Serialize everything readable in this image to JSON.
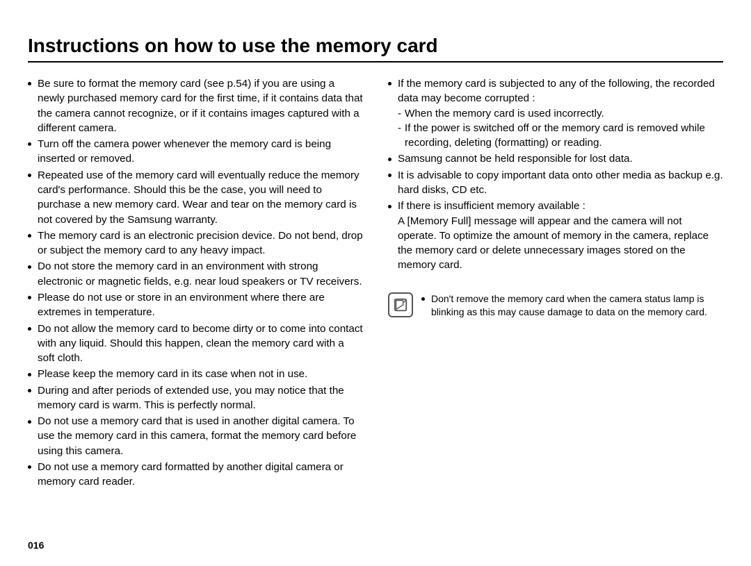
{
  "title": "Instructions on how to use the memory card",
  "page_number": "016",
  "left_bullets": [
    "Be sure to format the memory card (see p.54) if you are using a newly purchased memory card for the first time, if it contains data that the camera cannot recognize, or if it contains images captured with a different camera.",
    "Turn off the camera power whenever the memory card is being inserted or removed.",
    "Repeated use of the memory card will eventually reduce the memory card's performance. Should this be the case, you will need to purchase a new memory card. Wear and tear on the memory card is not covered by the Samsung warranty.",
    "The memory card is an electronic precision device. Do not bend, drop or subject the memory card to any heavy impact.",
    "Do not store the memory card in an environment with strong electronic or magnetic fields, e.g. near loud speakers or TV receivers.",
    "Please do not use or store in an environment where there are extremes in temperature.",
    "Do not allow the memory card to become dirty or to come into contact with any liquid. Should this happen, clean the memory card with a soft cloth.",
    "Please keep the memory card in its case when not in use.",
    "During and after periods of extended use, you may notice that the memory card is warm. This is perfectly normal.",
    "Do not use a memory card that is used in another digital camera. To use the memory card in this camera, format the memory card before using this camera.",
    "Do not use a memory card formatted by another digital camera or memory card reader."
  ],
  "right_bullets_1": {
    "lead": "If the memory card is subjected to any of the following, the recorded data may become corrupted :",
    "sub": [
      "When the memory card is used incorrectly.",
      "If the power is switched off or the memory card is removed while recording, deleting (formatting) or reading."
    ]
  },
  "right_bullets_rest": [
    "Samsung cannot be held responsible for lost data.",
    "It is advisable to copy important data onto other media as backup e.g. hard disks, CD etc.",
    "If there is insufficient memory available :\nA [Memory Full] message will appear and the camera will not operate. To optimize the amount of memory in the camera, replace the memory card or delete unnecessary images stored on the memory card."
  ],
  "note": "Don't remove the memory card when the camera status lamp is blinking as this may cause damage to data on the memory card."
}
